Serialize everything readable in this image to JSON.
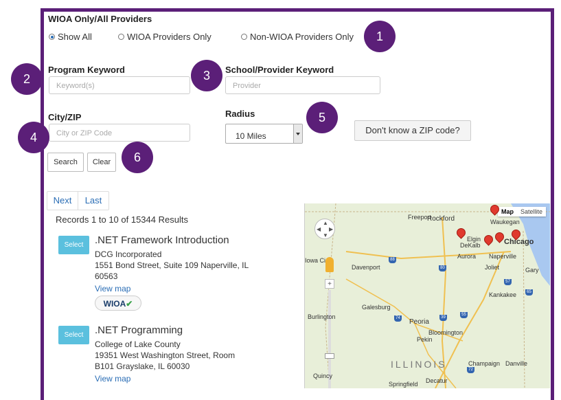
{
  "filter": {
    "heading": "WIOA Only/All Providers",
    "options": [
      "Show All",
      "WIOA Providers Only",
      "Non-WIOA Providers Only"
    ],
    "selected": "Show All"
  },
  "fields": {
    "program_label": "Program Keyword",
    "program_placeholder": "Keyword(s)",
    "provider_label": "School/Provider Keyword",
    "provider_placeholder": "Provider",
    "city_label": "City/ZIP",
    "city_placeholder": "City or ZIP Code",
    "radius_label": "Radius",
    "radius_value": "10 Miles",
    "zip_help": "Don't know a ZIP code?"
  },
  "actions": {
    "search": "Search",
    "clear": "Clear"
  },
  "callouts": [
    "1",
    "2",
    "3",
    "4",
    "5",
    "6"
  ],
  "pager": {
    "next": "Next",
    "last": "Last"
  },
  "summary": "Records 1 to 10 of 15344 Results",
  "results": [
    {
      "select": "Select",
      "title": ".NET Framework Introduction",
      "provider": "DCG Incorporated",
      "address1": "1551 Bond Street, Suite 109 Naperville, IL",
      "address2": "60563",
      "view": "View map",
      "badge": "WIOA"
    },
    {
      "select": "Select",
      "title": ".NET Programming",
      "provider": "College of Lake County",
      "address1": "19351 West Washington Street, Room",
      "address2": "B101 Grayslake, IL 60030",
      "view": "View map"
    }
  ],
  "map": {
    "type_options": [
      "Map",
      "Satellite"
    ],
    "selected": "Map",
    "state": "ILLINOIS",
    "cities": [
      "Rockford",
      "Freeport",
      "Waukegan",
      "Elgin",
      "DeKalb",
      "Chicago",
      "Aurora",
      "Naperville",
      "Joliet",
      "Gary",
      "Davenport",
      "Kankakee",
      "Galesburg",
      "Peoria",
      "Burlington",
      "Pekin",
      "Bloomington",
      "Champaign",
      "Danville",
      "Quincy",
      "Springfield",
      "Decatur",
      "Iowa Ci"
    ],
    "highways": [
      "88",
      "80",
      "74",
      "39",
      "55",
      "57",
      "65",
      "72"
    ],
    "colors": {
      "land": "#e8efd9",
      "water": "#a9c8f0",
      "pin": "#e03a2e"
    }
  },
  "colors": {
    "frame": "#5b1f78",
    "link": "#2a6db5",
    "select_button": "#5bc0de"
  }
}
